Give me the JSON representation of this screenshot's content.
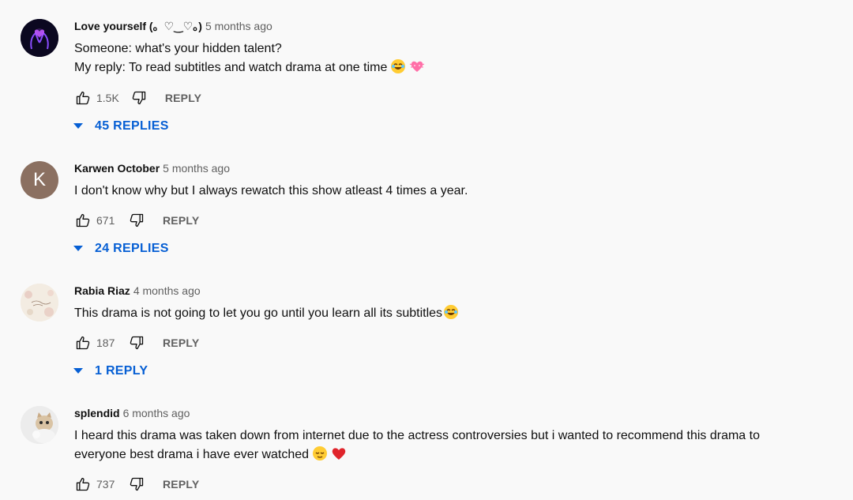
{
  "comments": [
    {
      "author": "Love yourself (。♡‿♡。)",
      "time": "5 months ago",
      "text_lines": [
        "Someone: what's your hidden talent?",
        "My reply: To read subtitles and watch drama at one time"
      ],
      "emojis": [
        "laughing-emoji",
        "pink-heart-emoji"
      ],
      "likes": "1.5K",
      "reply_label": "REPLY",
      "replies_label": "45 REPLIES",
      "avatar": "purple-heart-hands-avatar"
    },
    {
      "author": "Karwen October",
      "time": "5 months ago",
      "text_lines": [
        "I don't know why but I always rewatch this show atleast 4 times a year."
      ],
      "likes": "671",
      "reply_label": "REPLY",
      "replies_label": "24 REPLIES",
      "avatar_letter": "K"
    },
    {
      "author": "Rabia Riaz",
      "time": "4 months ago",
      "text_lines": [
        "This drama is not going to let you go until you learn all its subtitles"
      ],
      "emojis": [
        "laughing-emoji"
      ],
      "likes": "187",
      "reply_label": "REPLY",
      "replies_label": "1 REPLY",
      "avatar": "floral-avatar"
    },
    {
      "author": "splendid",
      "time": "6 months ago",
      "text_lines": [
        "I heard this drama was taken down from internet due to the actress controversies but i wanted to recommend this drama to",
        "everyone best drama i have ever watched"
      ],
      "emojis": [
        "relieved-emoji",
        "red-heart-emoji"
      ],
      "likes": "737",
      "reply_label": "REPLY",
      "avatar": "cat-avatar"
    }
  ],
  "colors": {
    "background": "#f9f9f9",
    "link_blue": "#065fd4",
    "secondary_text": "#606060"
  }
}
